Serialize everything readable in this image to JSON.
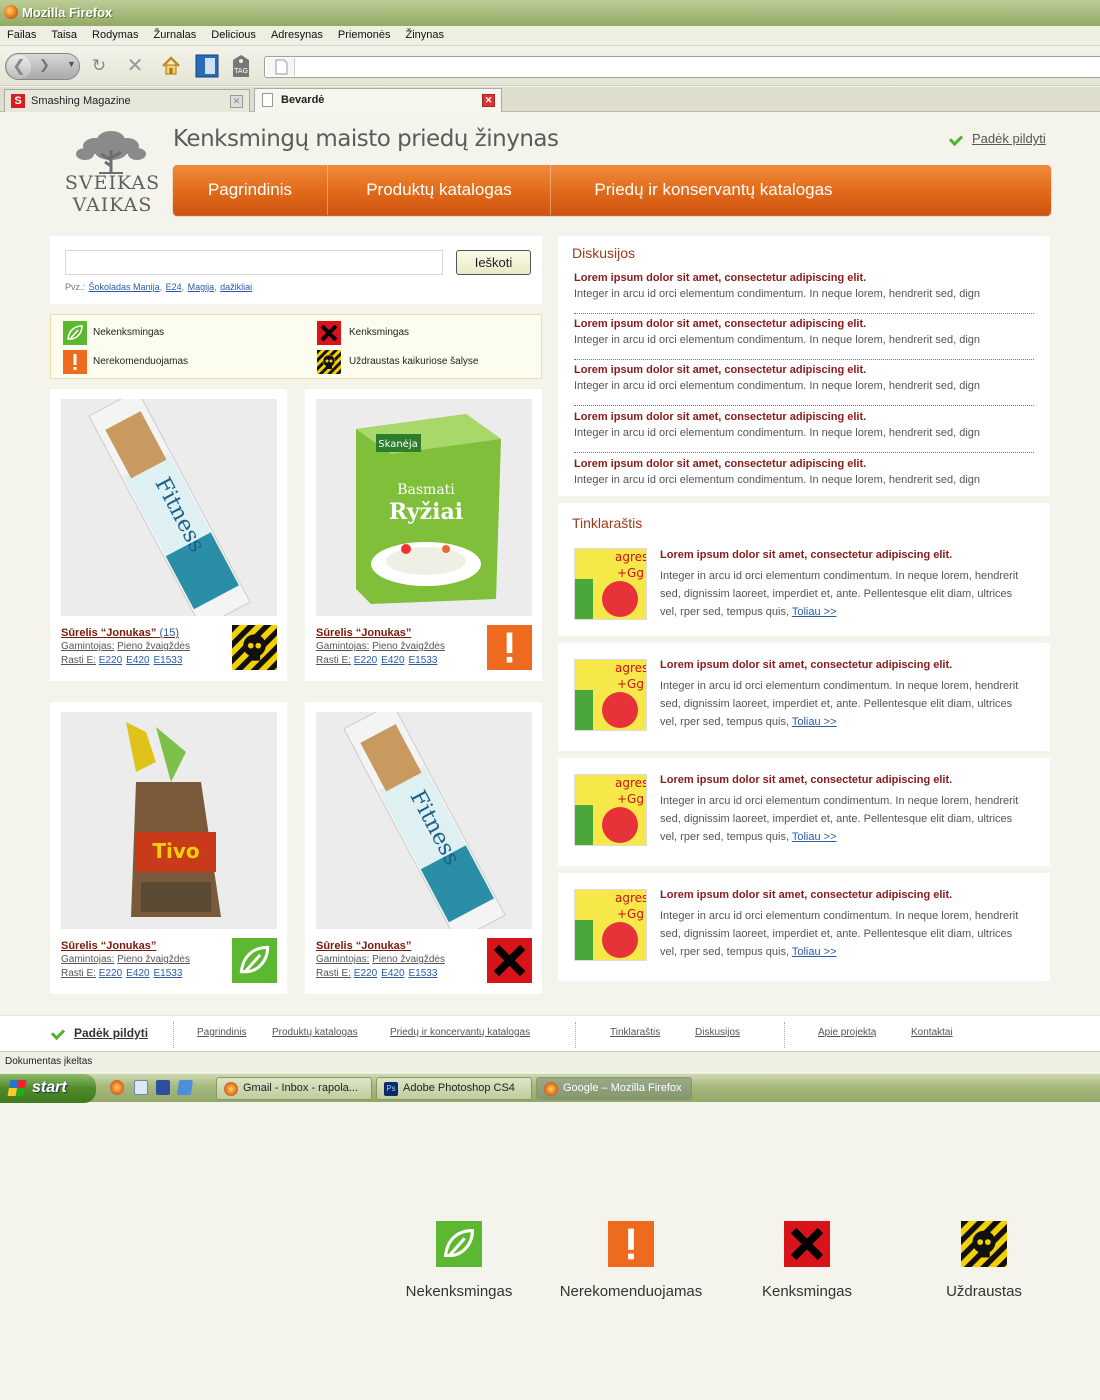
{
  "window": {
    "title": "Mozilla Firefox"
  },
  "menu": [
    "Failas",
    "Taisa",
    "Rodymas",
    "Žurnalas",
    "Delicious",
    "Adresynas",
    "Priemonės",
    "Žinynas"
  ],
  "tabs": [
    {
      "label": "Smashing Magazine",
      "active": false
    },
    {
      "label": "Bevardė",
      "active": true
    }
  ],
  "header": {
    "logo_line1": "SVEIKAS",
    "logo_line2": "VAIKAS",
    "title": "Kenksmingų maisto priedų žinynas",
    "help": "Padėk pildyti"
  },
  "nav": [
    "Pagrindinis",
    "Produktų katalogas",
    "Priedų ir konservantų katalogas"
  ],
  "search": {
    "button": "Ieškoti",
    "example_prefix": "Pvz.:",
    "examples": [
      "Šokoladas Manija",
      "E24",
      "Magija",
      "dažikliai"
    ]
  },
  "legend": [
    {
      "label": "Nekenksmingas",
      "icon": "leaf-icon"
    },
    {
      "label": "Kenksmingas",
      "icon": "x-icon"
    },
    {
      "label": "Nerekomenduojamas",
      "icon": "exclamation-icon"
    },
    {
      "label": "Uždraustas kaikuriose šalyse",
      "icon": "skull-icon"
    }
  ],
  "products": [
    {
      "name": "Sūrelis “Jonukas”",
      "count": "(15)",
      "maker_label": "Gamintojas:",
      "maker": "Pieno žvaigždės",
      "e_label": "Rasti E:",
      "e": [
        "E220",
        "E420",
        "E1533"
      ],
      "status": "skull",
      "image": "fitness-bar"
    },
    {
      "name": "Sūrelis “Jonukas”",
      "count": "",
      "maker_label": "Gamintojas:",
      "maker": "Pieno žvaigždės",
      "e_label": "Rasti E:",
      "e": [
        "E220",
        "E420",
        "E1533"
      ],
      "status": "exclamation",
      "image": "rice-box"
    },
    {
      "name": "Sūrelis “Jonukas”",
      "count": "",
      "maker_label": "Gamintojas:",
      "maker": "Pieno žvaigždės",
      "e_label": "Rasti E:",
      "e": [
        "E220",
        "E420",
        "E1533"
      ],
      "status": "leaf",
      "image": "bread-bag"
    },
    {
      "name": "Sūrelis “Jonukas”",
      "count": "",
      "maker_label": "Gamintojas:",
      "maker": "Pieno žvaigždės",
      "e_label": "Rasti E:",
      "e": [
        "E220",
        "E420",
        "E1533"
      ],
      "status": "x",
      "image": "fitness-bar"
    }
  ],
  "discussions": {
    "heading": "Diskusijos",
    "items": [
      {
        "title": "Lorem ipsum dolor sit amet, consectetur adipiscing elit.",
        "text": "Integer in arcu id orci elementum condimentum. In neque lorem, hendrerit sed, dign"
      },
      {
        "title": "Lorem ipsum dolor sit amet, consectetur adipiscing elit.",
        "text": "Integer in arcu id orci elementum condimentum. In neque lorem, hendrerit sed, dign"
      },
      {
        "title": "Lorem ipsum dolor sit amet, consectetur adipiscing elit.",
        "text": "Integer in arcu id orci elementum condimentum. In neque lorem, hendrerit sed, dign"
      },
      {
        "title": "Lorem ipsum dolor sit amet, consectetur adipiscing elit.",
        "text": "Integer in arcu id orci elementum condimentum. In neque lorem, hendrerit sed, dign"
      },
      {
        "title": "Lorem ipsum dolor sit amet, consectetur adipiscing elit.",
        "text": "Integer in arcu id orci elementum condimentum. In neque lorem, hendrerit sed, dign"
      }
    ]
  },
  "blog": {
    "heading": "Tinklaraštis",
    "items": [
      {
        "title": "Lorem ipsum dolor sit amet, consectetur adipiscing elit.",
        "text": "Integer in arcu id orci elementum condimentum. In neque lorem, hendrerit sed, dignissim laoreet, imperdiet et, ante. Pellentesque elit diam, ultrices vel, rper sed, tempus quis,",
        "more": "Toliau >>"
      },
      {
        "title": "Lorem ipsum dolor sit amet, consectetur adipiscing elit.",
        "text": "Integer in arcu id orci elementum condimentum. In neque lorem, hendrerit sed, dignissim laoreet, imperdiet et, ante. Pellentesque elit diam, ultrices vel, rper sed, tempus quis,",
        "more": "Toliau >>"
      },
      {
        "title": "Lorem ipsum dolor sit amet, consectetur adipiscing elit.",
        "text": "Integer in arcu id orci elementum condimentum. In neque lorem, hendrerit sed, dignissim laoreet, imperdiet et, ante. Pellentesque elit diam, ultrices vel, rper sed, tempus quis,",
        "more": "Toliau >>"
      },
      {
        "title": "Lorem ipsum dolor sit amet, consectetur adipiscing elit.",
        "text": "Integer in arcu id orci elementum condimentum. In neque lorem, hendrerit sed, dignissim laoreet, imperdiet et, ante. Pellentesque elit diam, ultrices vel, rper sed, tempus quis,",
        "more": "Toliau >>"
      }
    ]
  },
  "footer": {
    "help": "Padėk pildyti",
    "links": [
      "Pagrindinis",
      "Produktų katalogas",
      "Priedų ir koncervantų katalogas",
      "Tinklaraštis",
      "Diskusijos",
      "Apie projektą",
      "Kontaktai"
    ]
  },
  "status": "Dokumentas įkeltas",
  "taskbar": {
    "start": "start",
    "tasks": [
      "Gmail - Inbox - rapola...",
      "Adobe Photoshop CS4",
      "Google – Mozilla Firefox"
    ]
  },
  "bottom_legend": [
    "Nekenksmingas",
    "Nerekomenduojamas",
    "Kenksmingas",
    "Uždraustas"
  ],
  "colors": {
    "accent": "#e06a1a",
    "link": "#2a5aa8",
    "dark_red": "#8b1a1a",
    "green": "#5cb830",
    "orange": "#ee6a1e",
    "red": "#d8141a",
    "yellow": "#f5d000"
  }
}
